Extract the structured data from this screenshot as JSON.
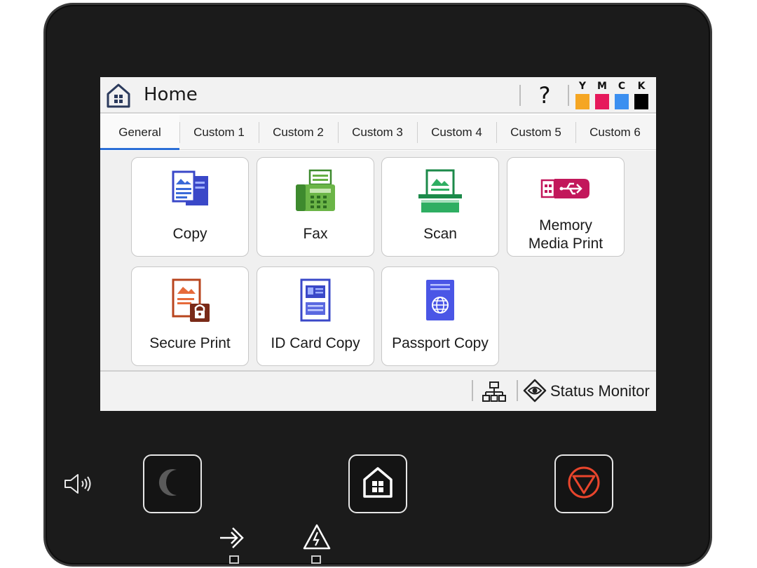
{
  "header": {
    "title": "Home",
    "help_label": "?",
    "inks": [
      {
        "label": "Y",
        "color": "#f5a623"
      },
      {
        "label": "M",
        "color": "#e6195c"
      },
      {
        "label": "C",
        "color": "#3b8ff0"
      },
      {
        "label": "K",
        "color": "#000000"
      }
    ]
  },
  "tabs": [
    {
      "label": "General",
      "active": true
    },
    {
      "label": "Custom 1"
    },
    {
      "label": "Custom 2"
    },
    {
      "label": "Custom 3"
    },
    {
      "label": "Custom 4"
    },
    {
      "label": "Custom 5"
    },
    {
      "label": "Custom 6"
    }
  ],
  "tiles": [
    {
      "label": "Copy",
      "icon": "copy-icon"
    },
    {
      "label": "Fax",
      "icon": "fax-icon"
    },
    {
      "label": "Scan",
      "icon": "scan-icon"
    },
    {
      "label_line1": "Memory",
      "label_line2": "Media Print",
      "icon": "usb-memory-icon"
    },
    {
      "label": "Secure Print",
      "icon": "secure-print-icon"
    },
    {
      "label": "ID Card Copy",
      "icon": "id-card-icon"
    },
    {
      "label": "Passport Copy",
      "icon": "passport-icon"
    }
  ],
  "footer": {
    "status_label": "Status Monitor",
    "network_icon": "network-icon",
    "status_icon": "eye-icon"
  },
  "hardware": {
    "volume_icon": "speaker-icon",
    "sleep_icon": "moon-icon",
    "home_icon": "home-icon",
    "stop_icon": "stop-icon",
    "data_led_icon": "data-arrow-icon",
    "error_led_icon": "warning-icon"
  }
}
